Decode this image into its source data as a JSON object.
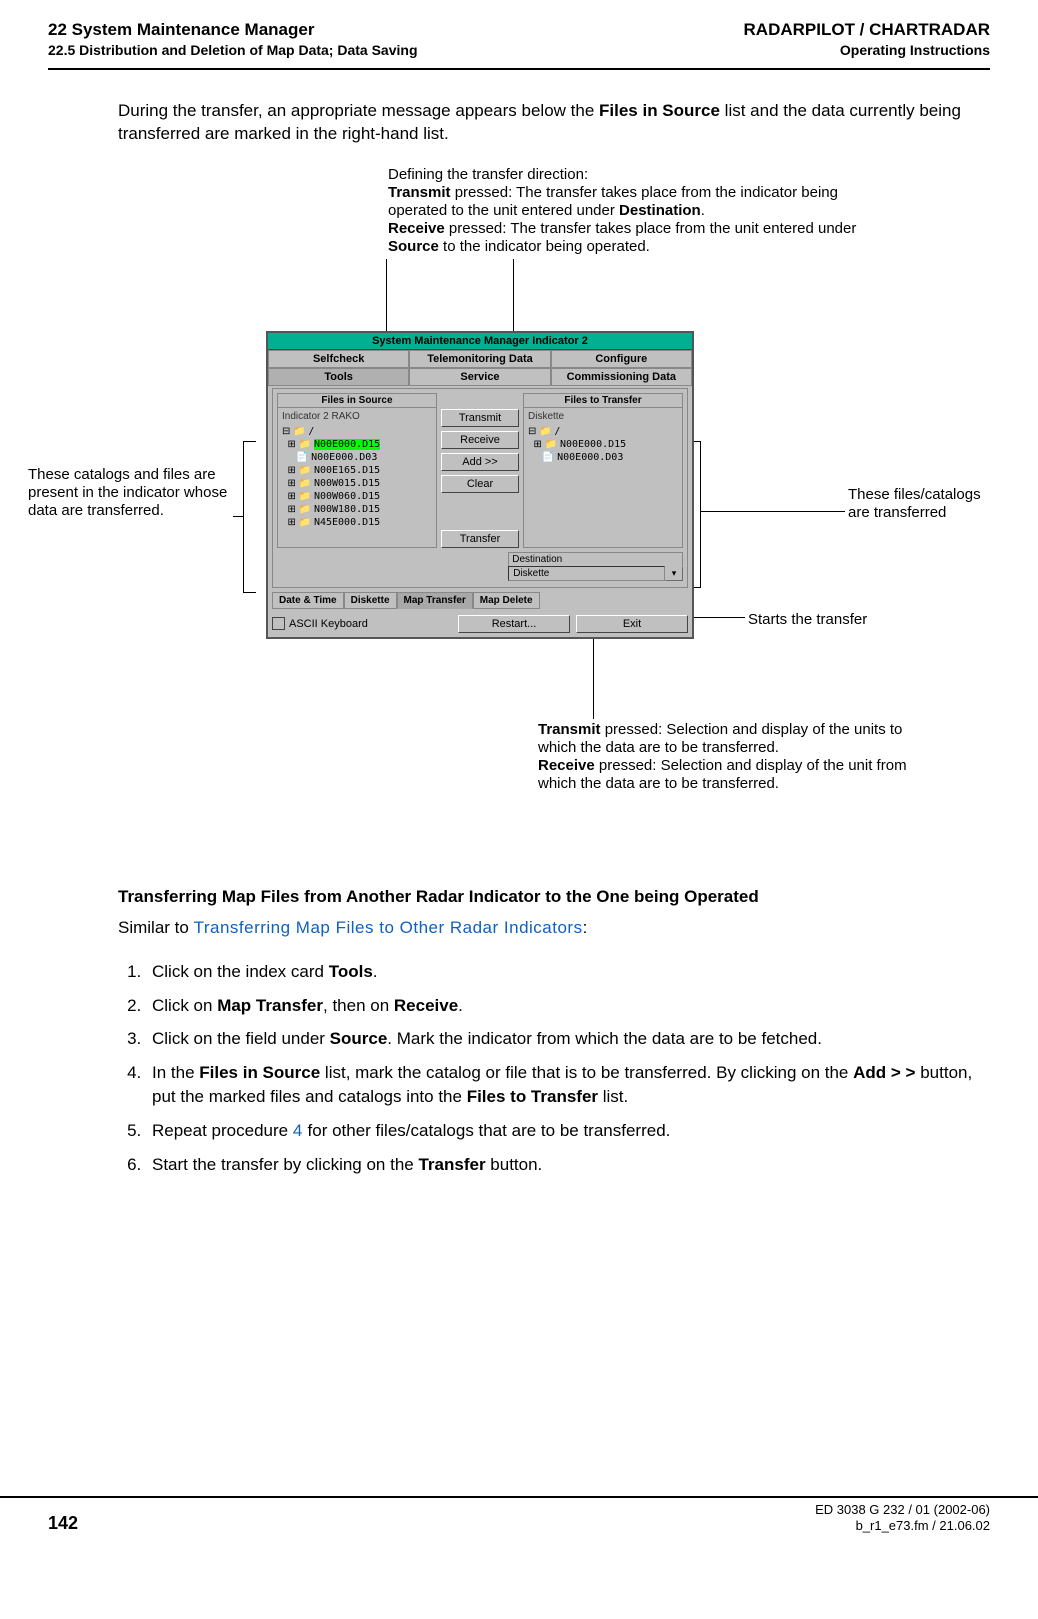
{
  "header": {
    "left_title": "22  System Maintenance Manager",
    "right_title": "RADARPILOT / CHARTRADAR",
    "left_sub": "22.5  Distribution and Deletion of Map Data; Data Saving",
    "right_sub": "Operating Instructions"
  },
  "intro_para": {
    "t1": "During the transfer, an appropriate message appears below the ",
    "b1": "Files in Source",
    "t2": " list and the data currently being transferred are marked in the right-hand list."
  },
  "callouts": {
    "top": {
      "line1": "Defining the transfer direction:",
      "b1": "Transmit",
      "line2a": " pressed: The transfer takes place from the indicator being operated to the unit entered under ",
      "b2": "Destination",
      "line2b": ".",
      "b3": "Receive",
      "line3a": " pressed: The transfer takes place from the unit entered under ",
      "b4": "Source",
      "line3b": " to the indicator being operated."
    },
    "left_note": "These catalogs and files are present in the indicator whose data are transferred.",
    "right_note": "These files/catalogs are transferred",
    "starts": "Starts the transfer",
    "bottom": {
      "b1": "Transmit",
      "t1": " pressed: Selection and display of the units to which the data are to be transferred.",
      "b2": "Receive",
      "t2": " pressed: Selection and display of the unit from which the data are to be transferred."
    }
  },
  "gui": {
    "title": "System Maintenance Manager Indicator 2",
    "tabs_top": {
      "a": "Selfcheck",
      "b": "Telemonitoring Data",
      "c": "Configure"
    },
    "tabs_mid": {
      "a": "Tools",
      "b": "Service",
      "c": "Commissioning Data"
    },
    "panel": {
      "left_title": "Files in Source",
      "indicator": "Indicator  2 RAKO",
      "files_left": {
        "root": "/",
        "sel": "N00E000.D15",
        "items": [
          "N00E000.D03",
          "N00E165.D15",
          "N00W015.D15",
          "N00W060.D15",
          "N00W180.D15",
          "N45E000.D15"
        ]
      },
      "mid": {
        "transmit": "Transmit",
        "receive": "Receive",
        "add": "Add >>",
        "clear": "Clear",
        "transfer": "Transfer"
      },
      "right_title": "Files to Transfer",
      "diskette": "Diskette",
      "files_right": {
        "root": "/",
        "items": [
          "N00E000.D15",
          "N00E000.D03"
        ]
      },
      "dest_label": "Destination",
      "dest_value": "Diskette"
    },
    "subtabs": {
      "a": "Date & Time",
      "b": "Diskette",
      "c": "Map Transfer",
      "d": "Map Delete"
    },
    "ascii": "ASCII Keyboard",
    "restart": "Restart...",
    "exit": "Exit"
  },
  "section": {
    "heading": "Transferring Map Files from Another Radar Indicator to the One being Operated",
    "similar_a": "Similar to ",
    "similar_link": "Transferring Map Files to Other Radar Indicators",
    "similar_b": ":",
    "steps": {
      "s1a": "Click on the index card ",
      "s1b": "Tools",
      "s1c": ".",
      "s2a": "Click on ",
      "s2b": "Map Transfer",
      "s2c": ", then on ",
      "s2d": "Receive",
      "s2e": ".",
      "s3a": "Click on the field under ",
      "s3b": "Source",
      "s3c": ". Mark the indicator from which the data are to be fetched.",
      "s4a": "In the ",
      "s4b": "Files in Source",
      "s4c": " list, mark the catalog or file that is to be transferred. By clicking on the ",
      "s4d": "Add > >",
      "s4e": " button, put the marked files and catalogs into the ",
      "s4f": "Files to Transfer",
      "s4g": " list.",
      "s5a": "Repeat procedure ",
      "s5b": "4",
      "s5c": " for other files/catalogs that are to be transferred.",
      "s6a": "Start the transfer by clicking on the ",
      "s6b": "Transfer",
      "s6c": " button."
    }
  },
  "footer": {
    "page": "142",
    "doc": "ED 3038 G 232 / 01 (2002-06)",
    "file": "b_r1_e73.fm / 21.06.02"
  }
}
